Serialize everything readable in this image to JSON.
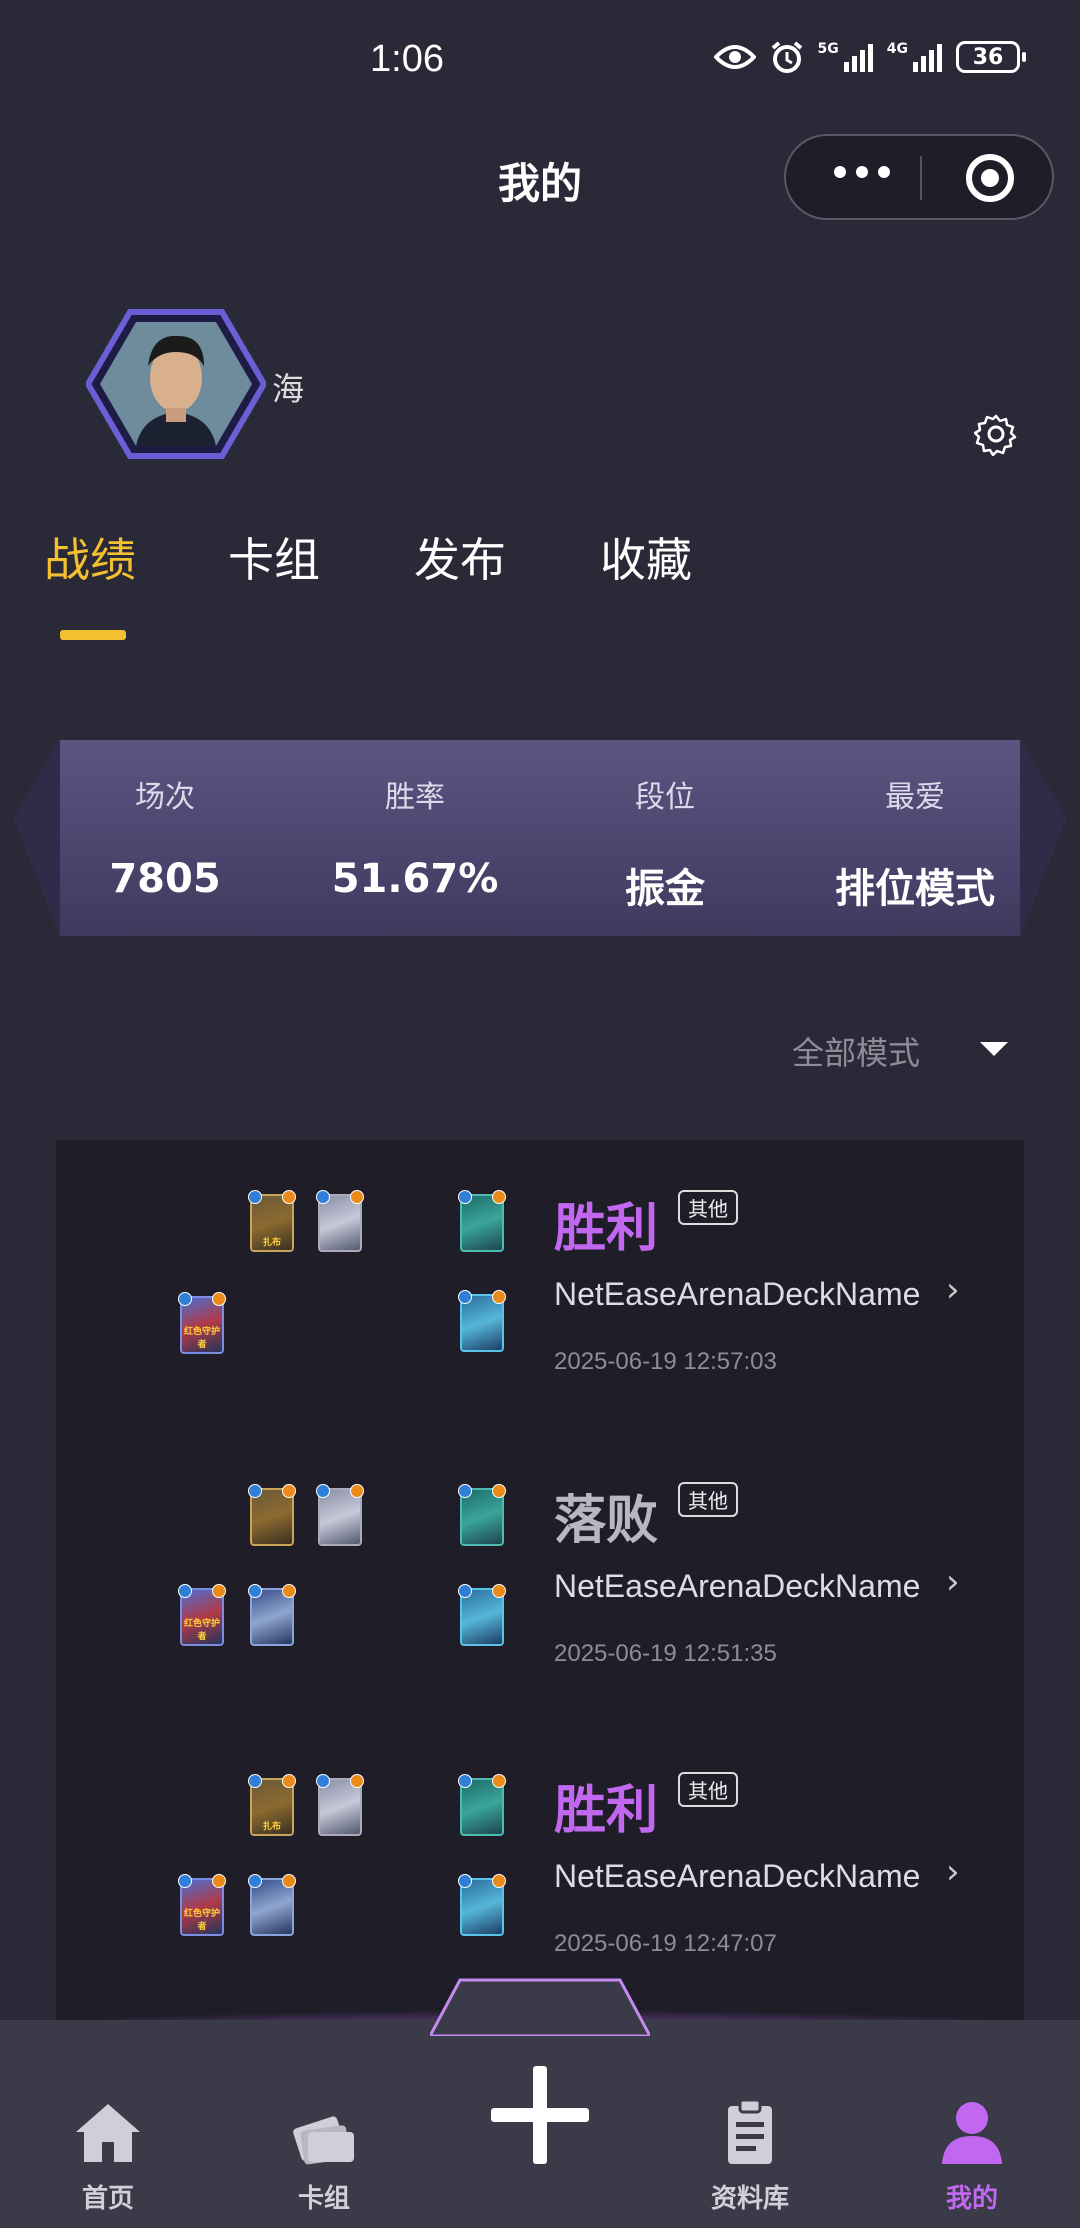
{
  "status_bar": {
    "time": "1:06",
    "signal1_label": "5G",
    "signal2_label": "4G",
    "battery": "36"
  },
  "header": {
    "title": "我的",
    "menu_icon": "more-dots-icon",
    "close_icon": "target-circle-icon"
  },
  "profile": {
    "username": "海",
    "settings_icon": "gear-icon"
  },
  "tabs": [
    {
      "label": "战绩",
      "active": true
    },
    {
      "label": "卡组",
      "active": false
    },
    {
      "label": "发布",
      "active": false
    },
    {
      "label": "收藏",
      "active": false
    }
  ],
  "stats": [
    {
      "label": "场次",
      "value": "7805"
    },
    {
      "label": "胜率",
      "value": "51.67%"
    },
    {
      "label": "段位",
      "value": "振金"
    },
    {
      "label": "最爱",
      "value": "排位模式"
    }
  ],
  "filter": {
    "label": "全部模式"
  },
  "matches": [
    {
      "result": "胜利",
      "mode": "其他",
      "deck": "NetEaseArenaDeckName",
      "time": "2025-06-19 12:57:03"
    },
    {
      "result": "落败",
      "mode": "其他",
      "deck": "NetEaseArenaDeckName",
      "time": "2025-06-19 12:51:35"
    },
    {
      "result": "胜利",
      "mode": "其他",
      "deck": "NetEaseArenaDeckName",
      "time": "2025-06-19 12:47:07"
    }
  ],
  "card_labels": {
    "a": "扎布",
    "c": "红色守护者"
  },
  "colors": {
    "accent_yellow": "#f3c130",
    "win_purple": "#c268f0",
    "background": "#2a2937"
  },
  "nav": [
    {
      "label": "首页",
      "icon": "home-icon"
    },
    {
      "label": "卡组",
      "icon": "cards-icon"
    },
    {
      "label": "",
      "icon": "plus-icon"
    },
    {
      "label": "资料库",
      "icon": "clipboard-icon"
    },
    {
      "label": "我的",
      "icon": "user-icon"
    }
  ]
}
